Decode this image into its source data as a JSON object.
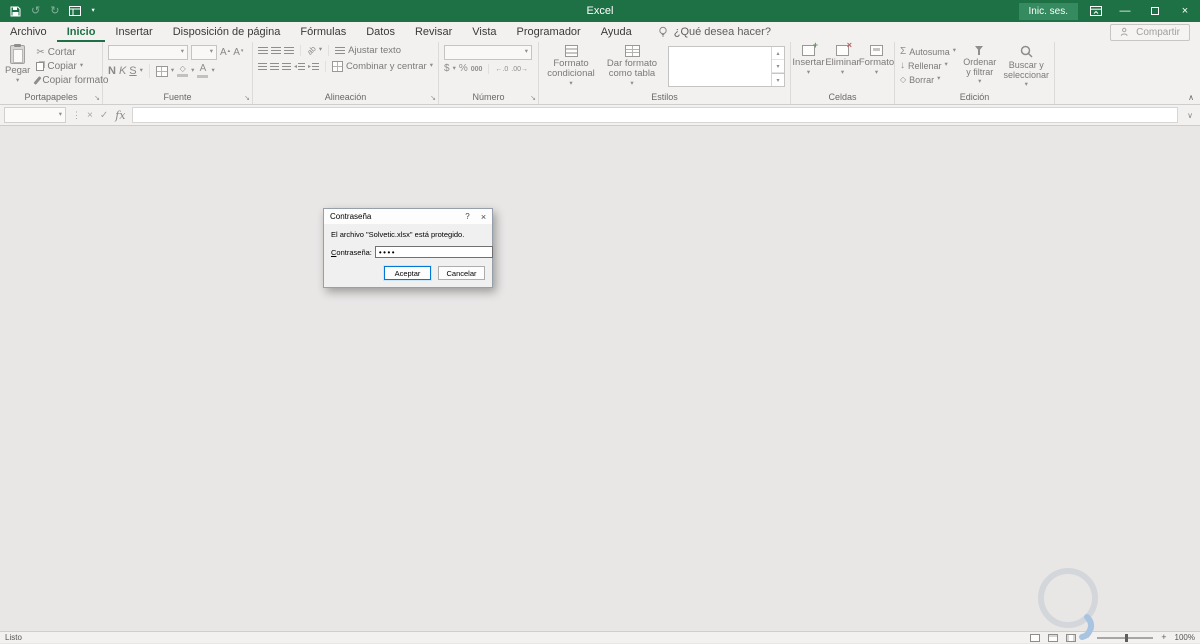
{
  "titlebar": {
    "title": "Excel",
    "signin": "Inic. ses."
  },
  "tabs": {
    "items": [
      {
        "label": "Archivo"
      },
      {
        "label": "Inicio"
      },
      {
        "label": "Insertar"
      },
      {
        "label": "Disposición de página"
      },
      {
        "label": "Fórmulas"
      },
      {
        "label": "Datos"
      },
      {
        "label": "Revisar"
      },
      {
        "label": "Vista"
      },
      {
        "label": "Programador"
      },
      {
        "label": "Ayuda"
      }
    ],
    "tell_me": "¿Qué desea hacer?",
    "share": "Compartir"
  },
  "ribbon": {
    "clipboard": {
      "name": "Portapapeles",
      "paste": "Pegar",
      "cut": "Cortar",
      "copy": "Copiar",
      "format_painter": "Copiar formato"
    },
    "font": {
      "name": "Fuente",
      "bold": "N",
      "italic": "K",
      "underline": "S"
    },
    "alignment": {
      "name": "Alineación",
      "wrap": "Ajustar texto",
      "merge": "Combinar y centrar"
    },
    "number": {
      "name": "Número",
      "currency": "$",
      "percent": "%",
      "thousands": "000"
    },
    "styles": {
      "name": "Estilos",
      "conditional": "Formato condicional",
      "format_table": "Dar formato como tabla"
    },
    "cells": {
      "name": "Celdas",
      "insert": "Insertar",
      "delete": "Eliminar",
      "format": "Formato"
    },
    "editing": {
      "name": "Edición",
      "autosum": "Autosuma",
      "fill": "Rellenar",
      "clear": "Borrar",
      "sort": "Ordenar y filtrar",
      "find": "Buscar y seleccionar"
    }
  },
  "formula_bar": {
    "fx": "fx"
  },
  "dialog": {
    "title": "Contraseña",
    "help": "?",
    "close": "×",
    "message": "El archivo \"Solvetic.xlsx\" está protegido.",
    "password_label_accesskey": "C",
    "password_label_rest": "ontraseña:",
    "password_value": "••••",
    "ok": "Aceptar",
    "cancel": "Cancelar"
  },
  "statusbar": {
    "ready": "Listo",
    "zoom": "100%"
  },
  "icons": {
    "scissors": "✂",
    "undo": "↺",
    "redo": "↻",
    "sigma": "Σ",
    "fill_down": "↓",
    "caret_down": "▾",
    "caret_up": "▴",
    "collapse_ribbon": "∧",
    "expand_formula_bar": "∨",
    "cancel_x": "×",
    "enter_check": "✓",
    "vertical_dots": "⋮",
    "diamond": "◇",
    "letter_A": "A",
    "decimal_left": "←.0",
    "decimal_right": ".00→",
    "indent_left": "◂",
    "indent_right": "▸",
    "orientation": "ab",
    "launcher": "↘",
    "minimize": "—",
    "close": "×"
  }
}
